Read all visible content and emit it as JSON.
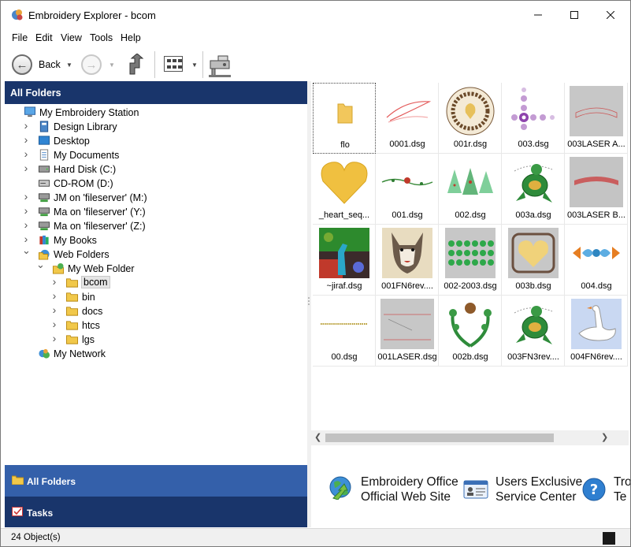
{
  "window": {
    "title": "Embroidery Explorer - bcom"
  },
  "menu": [
    "File",
    "Edit",
    "View",
    "Tools",
    "Help"
  ],
  "toolbar": {
    "back_label": "Back"
  },
  "left_pane": {
    "header": "All Folders",
    "tree": [
      {
        "label": "My Embroidery Station",
        "icon": "computer-icon",
        "expander": ""
      },
      {
        "label": "Design Library",
        "icon": "design-library-icon",
        "expander": ">"
      },
      {
        "label": "Desktop",
        "icon": "desktop-icon",
        "expander": ">"
      },
      {
        "label": "My Documents",
        "icon": "documents-icon",
        "expander": ">"
      },
      {
        "label": "Hard Disk (C:)",
        "icon": "hard-disk-icon",
        "expander": ">"
      },
      {
        "label": "CD-ROM (D:)",
        "icon": "cdrom-icon",
        "expander": ""
      },
      {
        "label": "JM on 'fileserver' (M:)",
        "icon": "network-drive-icon",
        "expander": ">"
      },
      {
        "label": "Ma on 'fileserver' (Y:)",
        "icon": "network-drive-icon",
        "expander": ">"
      },
      {
        "label": "Ma on 'fileserver' (Z:)",
        "icon": "network-drive-icon",
        "expander": ">"
      },
      {
        "label": "My Books",
        "icon": "books-icon",
        "expander": ">"
      },
      {
        "label": "Web Folders",
        "icon": "web-folders-icon",
        "expander": "v"
      },
      {
        "label": "My Web Folder",
        "icon": "web-folder-icon",
        "expander": "v"
      },
      {
        "label": "bcom",
        "icon": "folder-open-icon",
        "expander": ">"
      },
      {
        "label": "bin",
        "icon": "folder-icon",
        "expander": ">"
      },
      {
        "label": "docs",
        "icon": "folder-icon",
        "expander": ">"
      },
      {
        "label": "htcs",
        "icon": "folder-icon",
        "expander": ">"
      },
      {
        "label": "lgs",
        "icon": "folder-icon",
        "expander": ">"
      },
      {
        "label": "My Network",
        "icon": "network-icon",
        "expander": ""
      }
    ],
    "nav_all_folders": "All Folders",
    "nav_tasks": "Tasks"
  },
  "files": [
    {
      "name": "flo",
      "kind": "folder"
    },
    {
      "name": "0001.dsg",
      "kind": "swoosh"
    },
    {
      "name": "001r.dsg",
      "kind": "doily"
    },
    {
      "name": "003.dsg",
      "kind": "lilac-corner"
    },
    {
      "name": "003LASER A...",
      "kind": "grey-arch"
    },
    {
      "name": "_heart_seq...",
      "kind": "gold-heart"
    },
    {
      "name": "001.dsg",
      "kind": "vine"
    },
    {
      "name": "002.dsg",
      "kind": "trees"
    },
    {
      "name": "003a.dsg",
      "kind": "turtle"
    },
    {
      "name": "003LASER B...",
      "kind": "grey-text"
    },
    {
      "name": "~jiraf.dsg",
      "kind": "giraffe"
    },
    {
      "name": "001FN6rev....",
      "kind": "wolf"
    },
    {
      "name": "002-2003.dsg",
      "kind": "green-dots"
    },
    {
      "name": "003b.dsg",
      "kind": "heart-frame"
    },
    {
      "name": "004.dsg",
      "kind": "border"
    },
    {
      "name": "00.dsg",
      "kind": "dotted-line"
    },
    {
      "name": "001LASER.dsg",
      "kind": "grey-lines"
    },
    {
      "name": "002b.dsg",
      "kind": "wreath"
    },
    {
      "name": "003FN3rev....",
      "kind": "turtle"
    },
    {
      "name": "004FN6rev....",
      "kind": "swan"
    }
  ],
  "links": [
    {
      "line1": "Embroidery Office",
      "line2": "Official Web Site",
      "icon": "globe-arrow-icon"
    },
    {
      "line1": "Users Exclusive",
      "line2": "Service Center",
      "icon": "id-card-icon"
    },
    {
      "line1": "Tro",
      "line2": "Te",
      "icon": "help-icon"
    }
  ],
  "status": {
    "text": "24 Object(s)"
  }
}
